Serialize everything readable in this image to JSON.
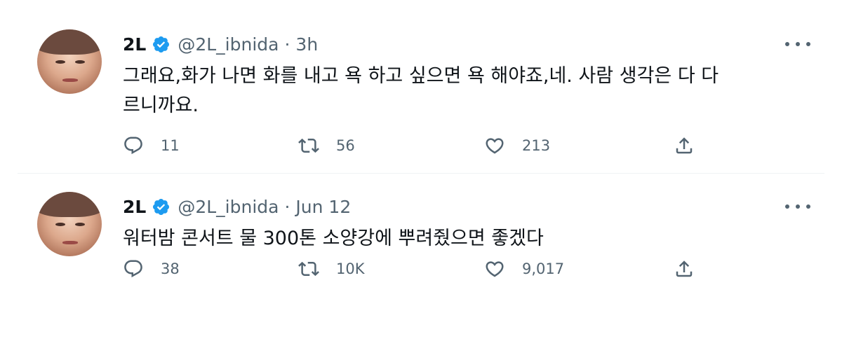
{
  "tweets": [
    {
      "name": "2L",
      "handle": "@2L_ibnida",
      "separator": "·",
      "time": "3h",
      "text": "그래요,화가 나면 화를 내고 욕 하고 싶으면 욕 해야죠,네. 사람 생각은 다 다\n르니까요.",
      "replies": "11",
      "retweets": "56",
      "likes": "213"
    },
    {
      "name": "2L",
      "handle": "@2L_ibnida",
      "separator": "·",
      "time": "Jun 12",
      "text": "워터밤 콘서트 물 300톤 소양강에 뿌려줬으면 좋겠다",
      "replies": "38",
      "retweets": "10K",
      "likes": "9,017"
    }
  ],
  "icons": {
    "verified": "verified-badge-icon",
    "more": "more-icon",
    "reply": "reply-icon",
    "retweet": "retweet-icon",
    "like": "heart-icon",
    "share": "share-icon"
  },
  "colors": {
    "verified": "#1d9bf0",
    "text": "#0f1419",
    "muted": "#536471",
    "divider": "#eff3f4"
  }
}
